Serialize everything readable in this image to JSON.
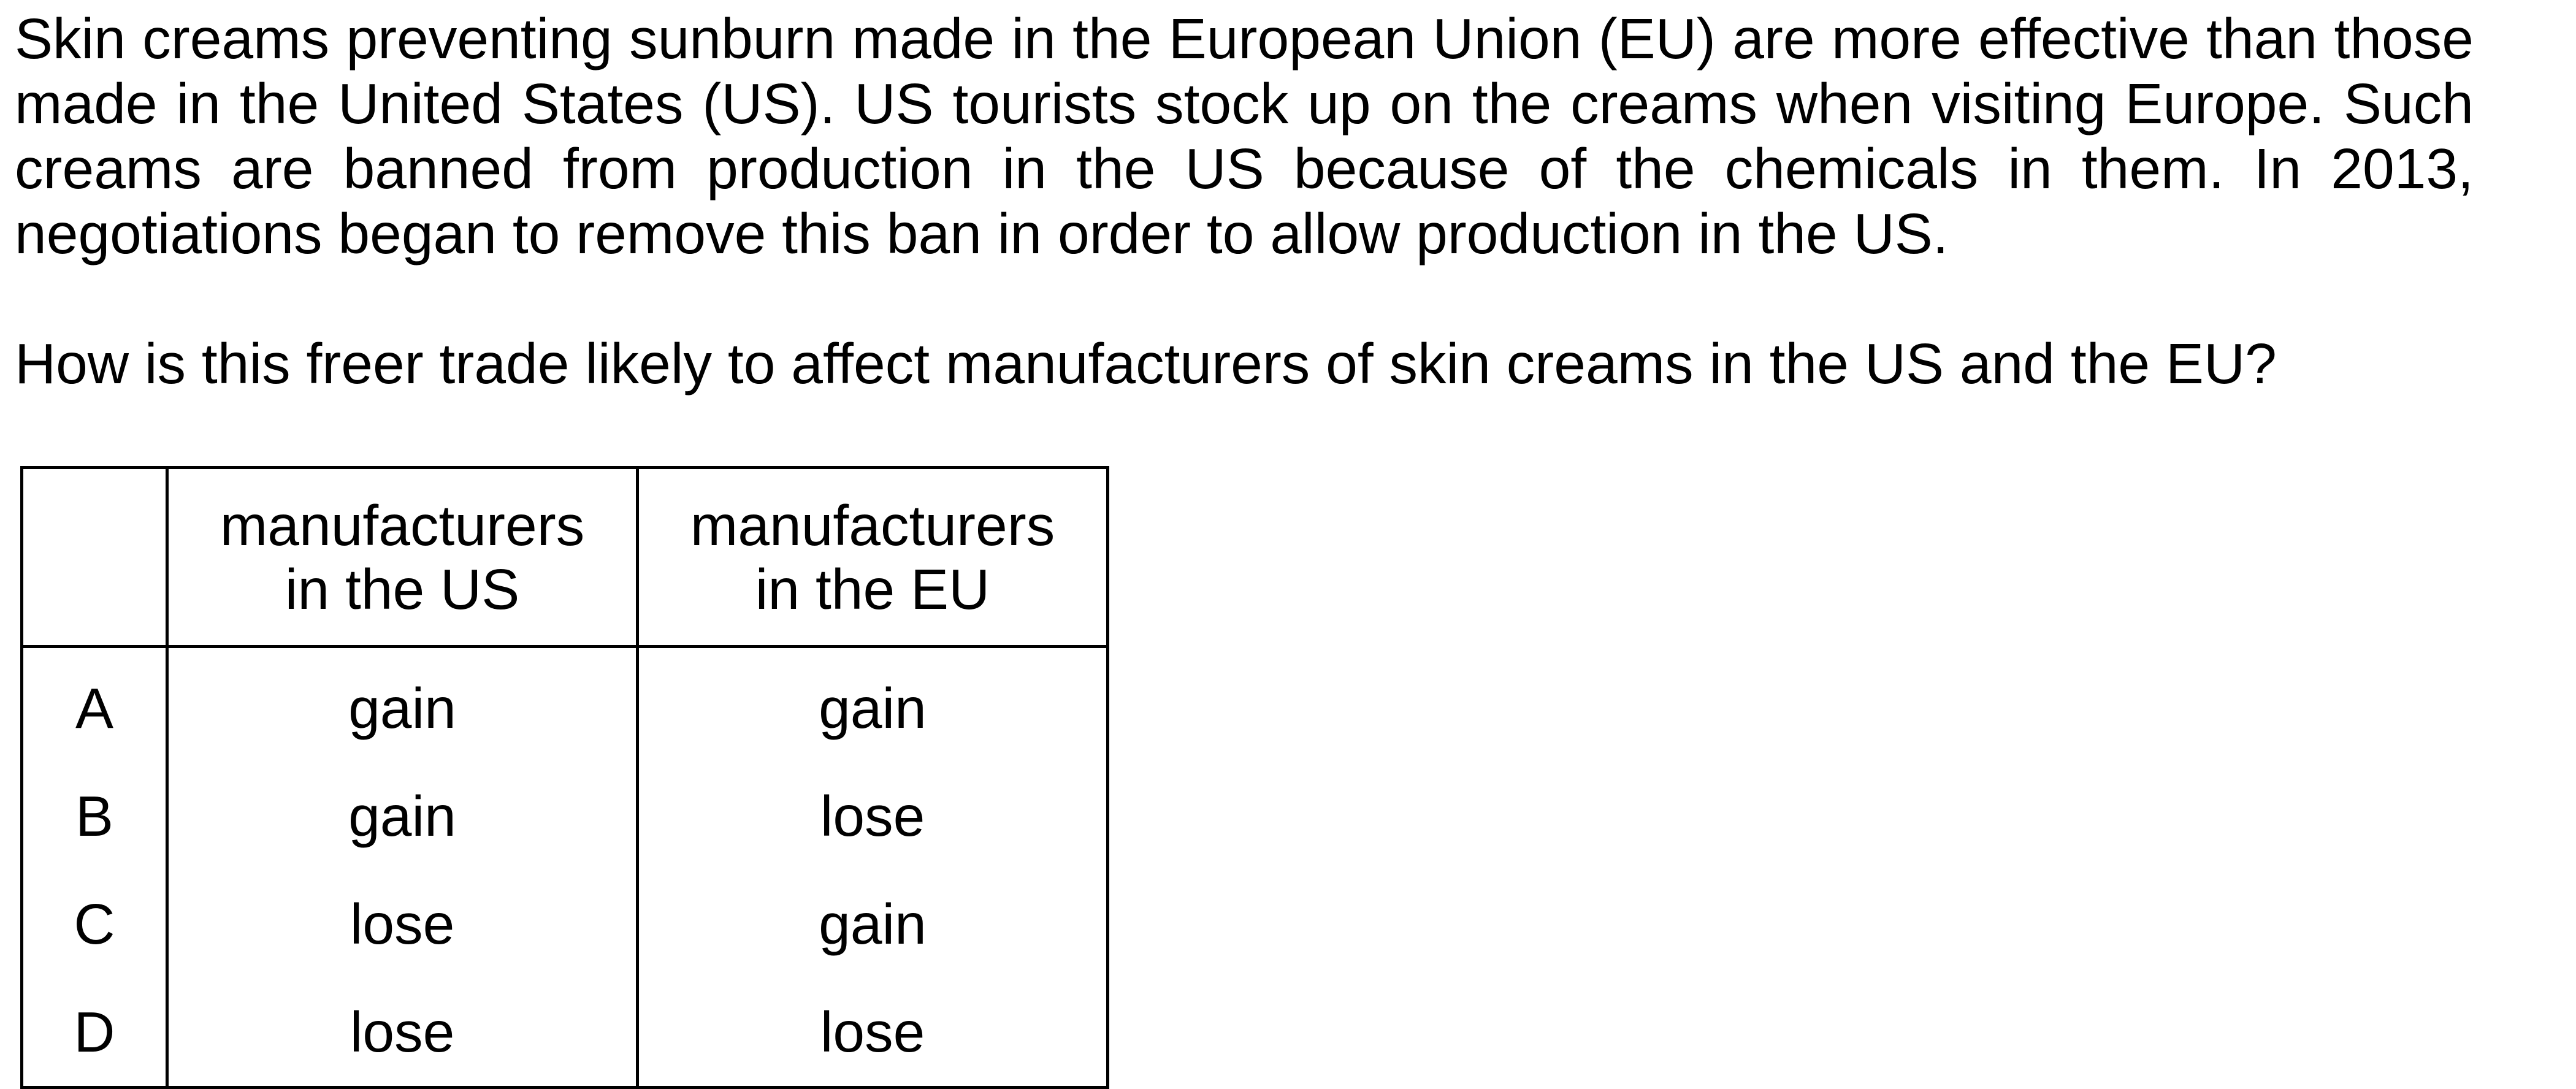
{
  "passage": "Skin creams preventing sunburn made in the European Union (EU) are more effective than those made in the United States (US). US tourists stock up on the creams when visiting Europe. Such creams are banned from production in the US because of the chemicals in them. In 2013, negotiations began to remove this ban in order to allow production in the US.",
  "question": "How is this freer trade likely to affect manufacturers of skin creams in the US and the EU?",
  "table": {
    "headers": {
      "us_line1": "manufacturers",
      "us_line2": "in the US",
      "eu_line1": "manufacturers",
      "eu_line2": "in the EU"
    },
    "rows": [
      {
        "letter": "A",
        "us": "gain",
        "eu": "gain"
      },
      {
        "letter": "B",
        "us": "gain",
        "eu": "lose"
      },
      {
        "letter": "C",
        "us": "lose",
        "eu": "gain"
      },
      {
        "letter": "D",
        "us": "lose",
        "eu": "lose"
      }
    ]
  }
}
